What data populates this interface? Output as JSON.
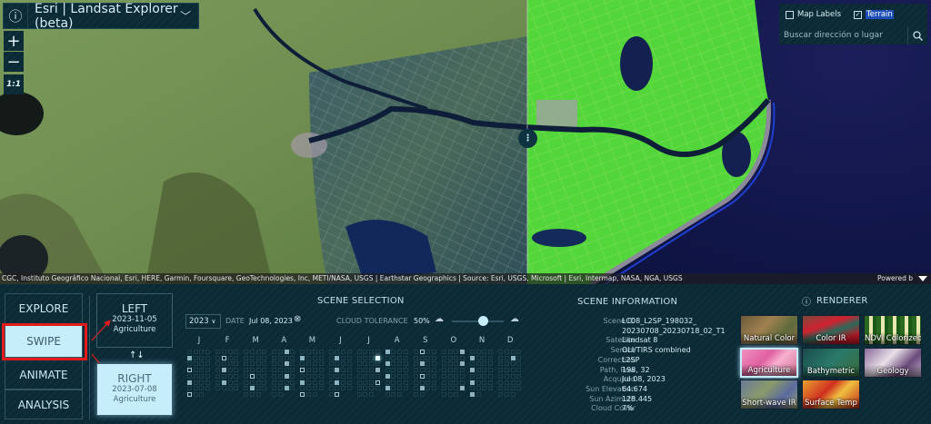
{
  "app": {
    "title": "Esri | Landsat Explorer (beta)",
    "info_icon": "info-icon",
    "menu_icon": "chevron-down-icon"
  },
  "map_controls": {
    "zoom_in": "+",
    "zoom_out": "−",
    "scale_1_1": "1:1"
  },
  "layers": {
    "map_labels": {
      "label": "Map Labels",
      "checked": false
    },
    "terrain": {
      "label": "Terrain",
      "checked": true
    }
  },
  "search": {
    "placeholder": "Buscar dirección o lugar",
    "icon": "search-icon"
  },
  "attribution": {
    "text": "CGC, Instituto Geográfico Nacional, Esri, HERE, Garmin, Foursquare, GeoTechnologies, Inc, METI/NASA, USGS | Earthstar Geographics | Source: Esri, USGS, Microsoft | Esri, Intermap, NASA, NGA, USGS",
    "powered": "Powered b"
  },
  "modes": [
    {
      "label": "EXPLORE",
      "active": false
    },
    {
      "label": "SWIPE",
      "active": true
    },
    {
      "label": "ANIMATE",
      "active": false
    },
    {
      "label": "ANALYSIS",
      "active": false
    }
  ],
  "swipe": {
    "left": {
      "label": "LEFT",
      "date": "2023-11-05",
      "renderer": "Agriculture"
    },
    "swap_icon": "↑↓",
    "right": {
      "label": "RIGHT",
      "date": "2023-07-08",
      "renderer": "Agriculture",
      "active": true
    }
  },
  "scene_selection": {
    "title": "SCENE SELECTION",
    "year": "2023",
    "date_label": "DATE",
    "date_value": "Jul 08, 2023",
    "cloud_label": "CLOUD TOLERANCE",
    "cloud_value": "50%",
    "cloud_percent": 50,
    "months": [
      {
        "letter": "J",
        "days": 31,
        "scenes": [
          [
            5,
            "f"
          ],
          [
            13,
            "o"
          ],
          [
            21,
            "f"
          ],
          [
            29,
            "o"
          ]
        ]
      },
      {
        "letter": "F",
        "days": 28,
        "scenes": [
          [
            6,
            "o"
          ],
          [
            14,
            "f"
          ],
          [
            22,
            "f"
          ]
        ]
      },
      {
        "letter": "M",
        "days": 31,
        "scenes": [
          [
            18,
            "o"
          ],
          [
            26,
            "f"
          ]
        ]
      },
      {
        "letter": "A",
        "days": 30,
        "scenes": [
          [
            3,
            "f"
          ],
          [
            11,
            "f"
          ],
          [
            19,
            "f"
          ],
          [
            27,
            "f"
          ]
        ]
      },
      {
        "letter": "M",
        "days": 31,
        "scenes": [
          [
            5,
            "f"
          ],
          [
            13,
            "o"
          ],
          [
            21,
            "f"
          ],
          [
            29,
            "o"
          ]
        ]
      },
      {
        "letter": "J",
        "days": 30,
        "scenes": [
          [
            6,
            "f"
          ],
          [
            14,
            "f"
          ],
          [
            22,
            "f"
          ],
          [
            30,
            "o"
          ]
        ]
      },
      {
        "letter": "J",
        "days": 31,
        "scenes": [
          [
            8,
            "s"
          ],
          [
            16,
            "f"
          ],
          [
            24,
            "o"
          ]
        ]
      },
      {
        "letter": "A",
        "days": 31,
        "scenes": [
          [
            1,
            "f"
          ],
          [
            9,
            "f"
          ],
          [
            17,
            "f"
          ],
          [
            25,
            "f"
          ]
        ]
      },
      {
        "letter": "S",
        "days": 30,
        "scenes": [
          [
            2,
            "o"
          ],
          [
            10,
            "f"
          ],
          [
            18,
            "o"
          ],
          [
            26,
            "f"
          ]
        ]
      },
      {
        "letter": "O",
        "days": 31,
        "scenes": [
          [
            4,
            "f"
          ],
          [
            12,
            "f"
          ],
          [
            28,
            "f"
          ]
        ]
      },
      {
        "letter": "N",
        "days": 30,
        "scenes": [
          [
            5,
            "f"
          ],
          [
            13,
            "f"
          ],
          [
            21,
            "f"
          ],
          [
            29,
            "f"
          ]
        ]
      },
      {
        "letter": "D",
        "days": 31,
        "scenes": [
          [
            7,
            "f"
          ]
        ]
      }
    ]
  },
  "scene_info": {
    "title": "SCENE INFORMATION",
    "rows": [
      {
        "k": "Scene ID",
        "v": "LC08_L2SP_198032_"
      },
      {
        "k": "",
        "v": "20230708_20230718_02_T1"
      },
      {
        "k": "Satellite",
        "v": "Landsat 8"
      },
      {
        "k": "Sensor",
        "v": "OLI/TIRS combined"
      },
      {
        "k": "Correction",
        "v": "L2SP"
      },
      {
        "k": "Path, Row",
        "v": "198, 32"
      },
      {
        "k": "Acquired",
        "v": "Jul 08, 2023"
      },
      {
        "k": "Sun Elevation",
        "v": "64.674"
      },
      {
        "k": "Sun Azimuth",
        "v": "128.445"
      },
      {
        "k": "Cloud Cover",
        "v": "7%"
      }
    ]
  },
  "renderer": {
    "title": "RENDERER",
    "items": [
      {
        "label": "Natural Color",
        "bg": "linear-gradient(135deg,#6b5a3a,#a08050 40%,#5e6b3c 70%,#8a6a45)"
      },
      {
        "label": "Color IR",
        "bg": "linear-gradient(160deg,#7a4a3a,#d02030 35%,#2a6a5a 55%,#c01828 80%)"
      },
      {
        "label": "NDVI Colorized",
        "bg": "repeating-linear-gradient(90deg,#2a6a20 0 5px,#e8e8b0 5px 9px,#1a5a18 9px 13px)"
      },
      {
        "label": "Agriculture",
        "bg": "linear-gradient(135deg,#f090c0,#e060a0 40%,#f8b0d0 60%,#d07090)",
        "selected": true
      },
      {
        "label": "Bathymetric",
        "bg": "linear-gradient(135deg,#1a4a4a,#2a7a6a 50%,#3a6a3a)"
      },
      {
        "label": "Geology",
        "bg": "linear-gradient(135deg,#8a6a9a,#e8e0e8 40%,#6a4a7a 70%,#c0b0c8)"
      },
      {
        "label": "Short-wave IR",
        "bg": "linear-gradient(135deg,#6a7a9a,#8a9a6a 40%,#5a6aa0 70%,#9aa070)"
      },
      {
        "label": "Surface Temp",
        "bg": "linear-gradient(135deg,#e8a030,#d03020 40%,#f0c040 60%,#c02818)"
      }
    ]
  }
}
